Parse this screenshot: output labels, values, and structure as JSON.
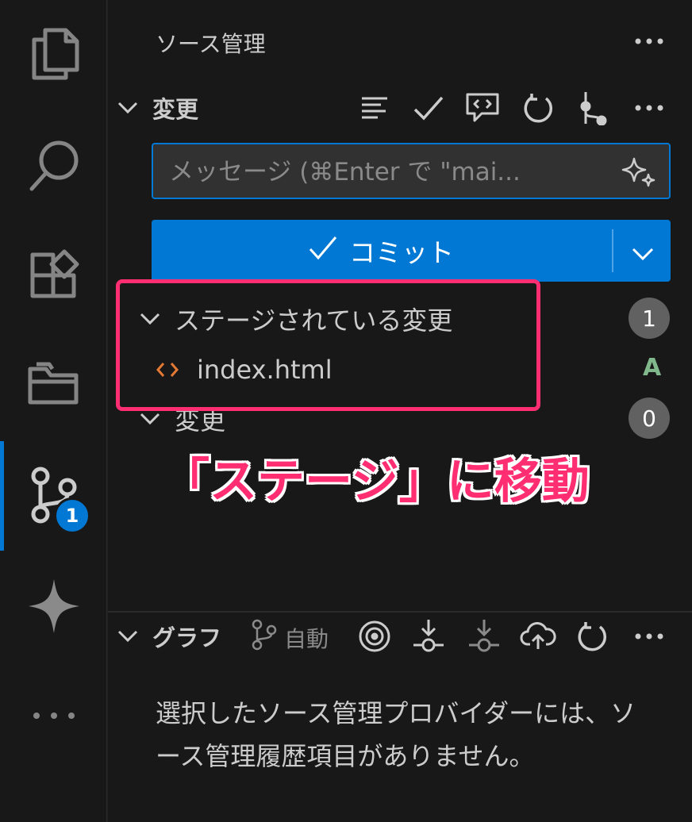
{
  "activity_bar": {
    "icons": [
      "explorer-icon",
      "search-icon",
      "extensions-icon",
      "folder-icon",
      "source-control-icon",
      "sparkle-icon",
      "more-icon"
    ],
    "scm_badge": "1"
  },
  "sidebar": {
    "title": "ソース管理",
    "changes_section": {
      "title": "変更",
      "toolbar": [
        "list-view-icon",
        "check-icon",
        "comment-code-icon",
        "refresh-icon",
        "graph-branch-icon",
        "more-icon"
      ]
    },
    "commit_message": {
      "value": "",
      "placeholder": "メッセージ (⌘Enter で \"mai..."
    },
    "commit_button": {
      "label": "コミット"
    },
    "staged_group": {
      "label": "ステージされている変更",
      "count": "1"
    },
    "staged_file": {
      "name": "index.html",
      "status": "A"
    },
    "changes_group": {
      "label": "変更",
      "count": "0"
    },
    "annotation": "「ステージ」に移動",
    "graph_section": {
      "title": "グラフ",
      "auto_label": "自動",
      "empty_message": "選択したソース管理プロバイダーには、ソース管理履歴項目がありません。"
    }
  },
  "colors": {
    "accent": "#0078d4",
    "highlight": "#ff2e73",
    "added": "#81b88b",
    "file_icon": "#e37933"
  }
}
